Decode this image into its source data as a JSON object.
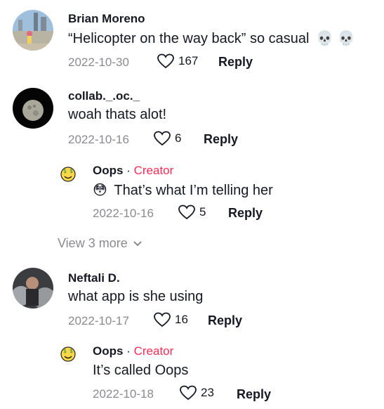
{
  "comments": [
    {
      "username": "Brian Moreno",
      "text": "“Helicopter on the way back” so casual",
      "emoji": "💀 💀",
      "date": "2022-10-30",
      "likes": "167",
      "reply_label": "Reply"
    },
    {
      "username": "collab._.oc._",
      "text": "woah thats alot!",
      "date": "2022-10-16",
      "likes": "6",
      "reply_label": "Reply",
      "replies": [
        {
          "username": "Oops",
          "separator": "·",
          "badge": "Creator",
          "emoji": "😳",
          "text": "That’s what I’m telling her",
          "date": "2022-10-16",
          "likes": "5",
          "reply_label": "Reply"
        }
      ],
      "view_more": "View 3 more"
    },
    {
      "username": "Neftali D.",
      "text": "what app is she using",
      "date": "2022-10-17",
      "likes": "16",
      "reply_label": "Reply",
      "replies": [
        {
          "username": "Oops",
          "separator": "·",
          "badge": "Creator",
          "text": "It’s called Oops",
          "date": "2022-10-18",
          "likes": "23",
          "reply_label": "Reply"
        }
      ]
    }
  ],
  "colors": {
    "creator": "#fe2c55",
    "muted": "#8a8b91",
    "text": "#161823"
  }
}
